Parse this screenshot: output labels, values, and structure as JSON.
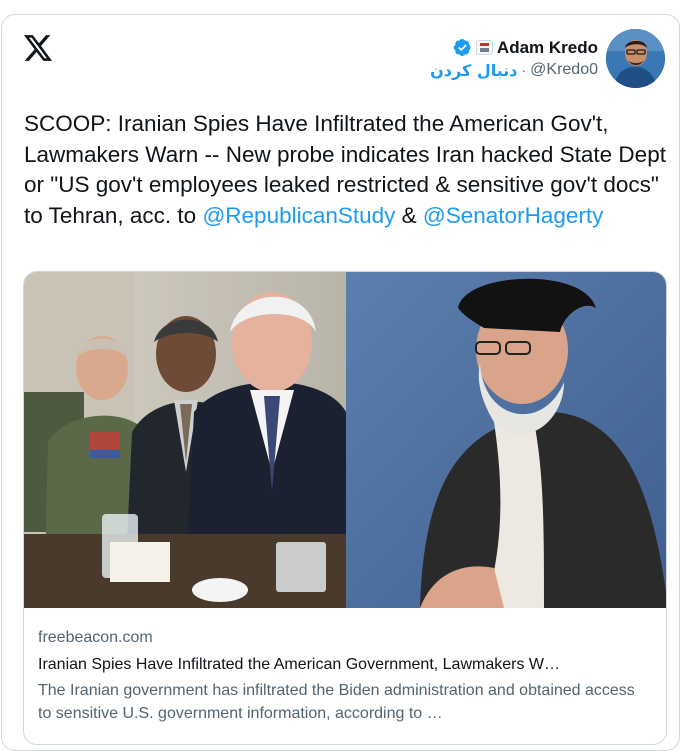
{
  "header": {
    "display_name": "Adam Kredo",
    "handle": "@Kredo0",
    "separator": "·",
    "follow_label": "دنبال کردن"
  },
  "tweet": {
    "text_main": "SCOOP: Iranian Spies Have Infiltrated the American Gov't, Lawmakers Warn -- New probe indicates Iran hacked State Dept or \"US gov't employees leaked restricted & sensitive gov't docs\" to Tehran,  acc. to ",
    "mention1": "@RepublicanStudy",
    "joiner": " & ",
    "mention2": "@SenatorHagerty"
  },
  "link_card": {
    "domain": "freebeacon.com",
    "title": "Iranian Spies Have Infiltrated the American Government, Lawmakers W…",
    "description": "The Iranian government has infiltrated the Biden administration and obtained access to sensitive U.S. government information, according to …"
  },
  "icons": [
    "x-logo-icon",
    "verified-badge-icon",
    "affiliate-badge-icon"
  ],
  "colors": {
    "accent": "#1d9bf0",
    "text": "#0f1419",
    "secondary": "#536471",
    "border": "#cfd9de"
  }
}
